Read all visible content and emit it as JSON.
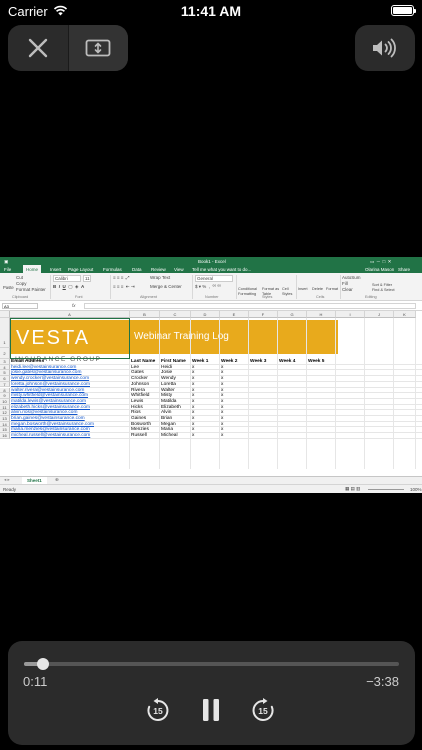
{
  "status_bar": {
    "carrier": "Carrier",
    "time": "11:41 AM",
    "battery_level": 1.0
  },
  "player": {
    "elapsed": "0:11",
    "remaining": "−3:38",
    "progress": 0.05
  },
  "excel": {
    "window_title": "Book1 - Excel",
    "search_hint": "Tell me what you want to do...",
    "user": "Olarina Mason",
    "share": "Share",
    "tabs": [
      "File",
      "Home",
      "Insert",
      "Page Layout",
      "Formulas",
      "Data",
      "Review",
      "View"
    ],
    "ribbon": {
      "paste": "Paste",
      "cut": "Cut",
      "copy": "Copy",
      "format_painter": "Format Painter",
      "font_name": "Calibri",
      "font_size": "11",
      "wrap_text": "Wrap Text",
      "merge_center": "Merge & Center",
      "number_format": "General",
      "conditional_formatting": "Conditional Formatting",
      "format_as_table": "Format as Table",
      "cell_styles": "Cell Styles",
      "insert": "Insert",
      "delete": "Delete",
      "format": "Format",
      "autosum": "AutoSum",
      "fill": "Fill",
      "clear": "Clear",
      "sort_filter": "Sort & Filter",
      "find_select": "Find & Select",
      "groups": [
        "Clipboard",
        "Font",
        "Alignment",
        "Number",
        "Styles",
        "Cells",
        "Editing"
      ]
    },
    "name_box": "A3",
    "fx": "fx",
    "columns": [
      "A",
      "B",
      "C",
      "D",
      "E",
      "F",
      "G",
      "H",
      "I",
      "J",
      "K"
    ],
    "rows": [
      "1",
      "2",
      "3",
      "4",
      "5",
      "6",
      "7",
      "8",
      "9",
      "10",
      "11",
      "12",
      "13",
      "14",
      "15",
      "16"
    ],
    "logo_text": "VESTA",
    "logo_sub": "INSURANCE GROUP",
    "banner_title": "Webinar Training Log",
    "headers": [
      "Email Address",
      "Last Name",
      "First Name",
      "Week 1",
      "Week 2",
      "Week 3",
      "Week 4",
      "Week 5"
    ],
    "records": [
      {
        "email": "heidi.lee@vestainsurance.com",
        "last": "Lee",
        "first": "Heidi",
        "w1": "x",
        "w2": "x"
      },
      {
        "email": "josie.gates@vestainsurance.com",
        "last": "Gates",
        "first": "Josie",
        "w1": "x",
        "w2": "x"
      },
      {
        "email": "wendy.crocker@vestainsurance.com",
        "last": "Crocker",
        "first": "Wendy",
        "w1": "x",
        "w2": "x"
      },
      {
        "email": "loretta.johnson@vestainsurance.com",
        "last": "Johnson",
        "first": "Loretta",
        "w1": "x",
        "w2": "x"
      },
      {
        "email": "walter.rivera@vestainsurance.com",
        "last": "Rivera",
        "first": "Walter",
        "w1": "x",
        "w2": "x"
      },
      {
        "email": "misty.whitfield@vestainsurance.com",
        "last": "Whitfield",
        "first": "Misty",
        "w1": "x",
        "w2": "x"
      },
      {
        "email": "matilda.lewis@vestainsurance.com",
        "last": "Lewis",
        "first": "Matilda",
        "w1": "x",
        "w2": "x"
      },
      {
        "email": "elizabeth.hicks@vestainsurance.com",
        "last": "Hicks",
        "first": "Elizabeth",
        "w1": "x",
        "w2": "x"
      },
      {
        "email": "alvin.rios@vestainsurance.com",
        "last": "Rios",
        "first": "Alvin",
        "w1": "x",
        "w2": "x"
      },
      {
        "email": "brian.gaines@vestainsurance.com",
        "last": "Gaines",
        "first": "Brian",
        "w1": "x",
        "w2": "x"
      },
      {
        "email": "megan.bosworth@vestainsurance.com",
        "last": "Bosworth",
        "first": "Megan",
        "w1": "x",
        "w2": "x"
      },
      {
        "email": "maria.menzies@vestainsurance.com",
        "last": "Menzies",
        "first": "Maria",
        "w1": "x",
        "w2": "x"
      },
      {
        "email": "micheal.russell@vestainsurance.com",
        "last": "Russell",
        "first": "Micheal",
        "w1": "x",
        "w2": "x"
      }
    ],
    "sheet_tab": "Sheet1",
    "status_text": "Ready",
    "zoom": "100%",
    "colors": {
      "excel_green": "#217346",
      "banner_gold": "#e8aa1c",
      "link_blue": "#1155cc"
    }
  }
}
